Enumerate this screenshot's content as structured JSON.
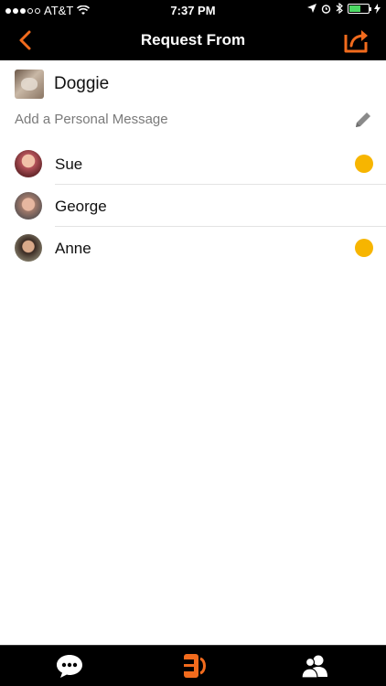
{
  "status_bar": {
    "carrier": "AT&T",
    "time": "7:37 PM"
  },
  "nav": {
    "title": "Request From",
    "back_icon": "chevron-left-icon",
    "share_icon": "share-export-icon",
    "accent_color": "#f26b1d"
  },
  "recipient": {
    "name": "Doggie"
  },
  "message": {
    "placeholder": "Add a Personal Message"
  },
  "contacts": [
    {
      "name": "Sue",
      "status_dot": true,
      "status_color": "#f7b500"
    },
    {
      "name": "George",
      "status_dot": false
    },
    {
      "name": "Anne",
      "status_dot": true,
      "status_color": "#f7b500"
    }
  ],
  "tabbar": {
    "items": [
      {
        "icon": "chat-bubble-icon",
        "active": false
      },
      {
        "icon": "request-stack-icon",
        "active": true
      },
      {
        "icon": "contacts-icon",
        "active": false
      }
    ]
  }
}
